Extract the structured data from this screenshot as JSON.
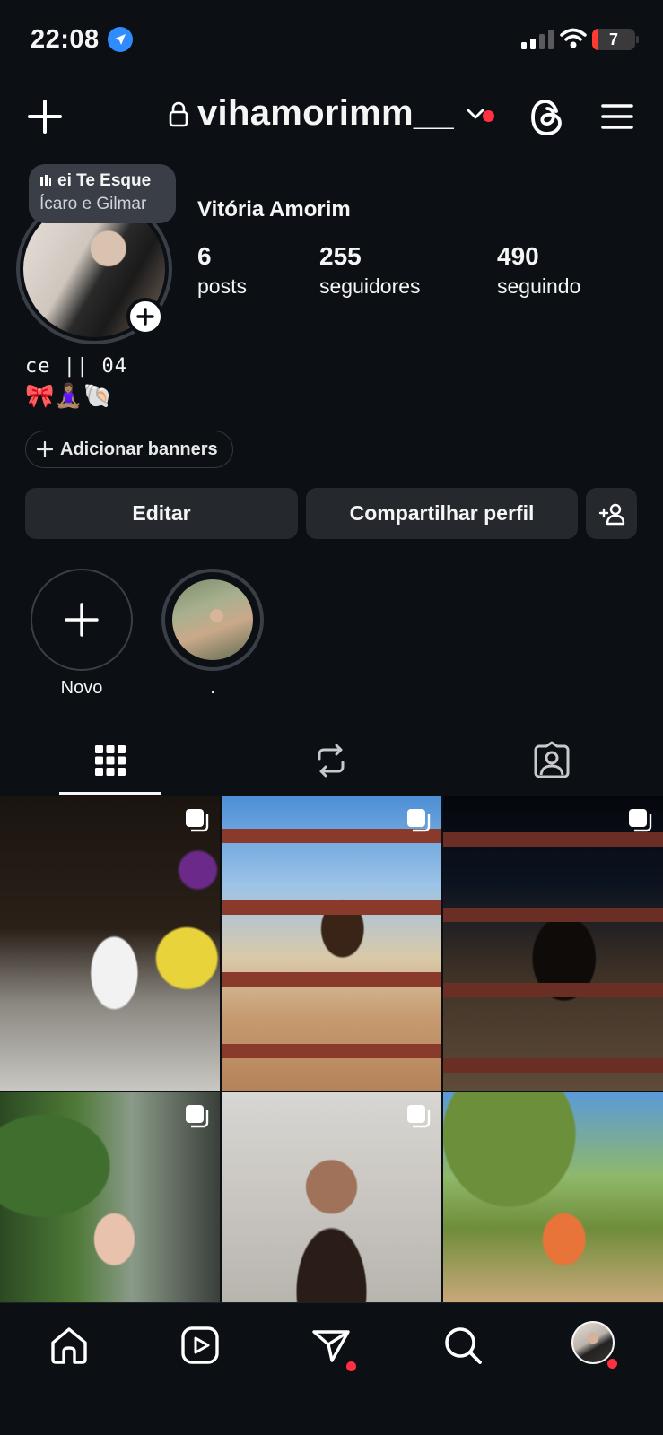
{
  "status_bar": {
    "time": "22:08",
    "battery": "7",
    "icons": [
      "location-arrow-icon",
      "cellular-signal-icon",
      "wifi-icon",
      "battery-icon"
    ]
  },
  "header": {
    "username": "vihamorimm__",
    "icons": [
      "plus-icon",
      "lock-icon",
      "chevron-down-icon",
      "threads-icon",
      "menu-icon"
    ]
  },
  "note": {
    "line1": "ei Te Esque",
    "line2": "Ícaro e Gilmar"
  },
  "profile": {
    "full_name": "Vitória Amorim",
    "stats": [
      {
        "value": "6",
        "label": "posts"
      },
      {
        "value": "255",
        "label": "seguidores"
      },
      {
        "value": "490",
        "label": "seguindo"
      }
    ],
    "bio_line1": "ce || 04",
    "bio_line2": "🎀🧘🏽‍♀️🐚",
    "add_banners": "Adicionar banners"
  },
  "actions": {
    "edit": "Editar",
    "share": "Compartilhar perfil"
  },
  "highlights": [
    {
      "label": "Novo"
    },
    {
      "label": "."
    }
  ],
  "tabs": [
    "grid-icon",
    "reposts-icon",
    "tagged-icon"
  ],
  "grid_posts": [
    {
      "multi": true
    },
    {
      "multi": true
    },
    {
      "multi": true
    },
    {
      "multi": true
    },
    {
      "multi": true
    },
    {
      "multi": false
    }
  ],
  "nav": [
    "home-icon",
    "reels-icon",
    "direct-icon",
    "search-icon",
    "profile-avatar"
  ],
  "colors": {
    "background": "#0c1014",
    "button": "#25292e",
    "notification": "#ff3040",
    "location": "#2f8cff"
  }
}
